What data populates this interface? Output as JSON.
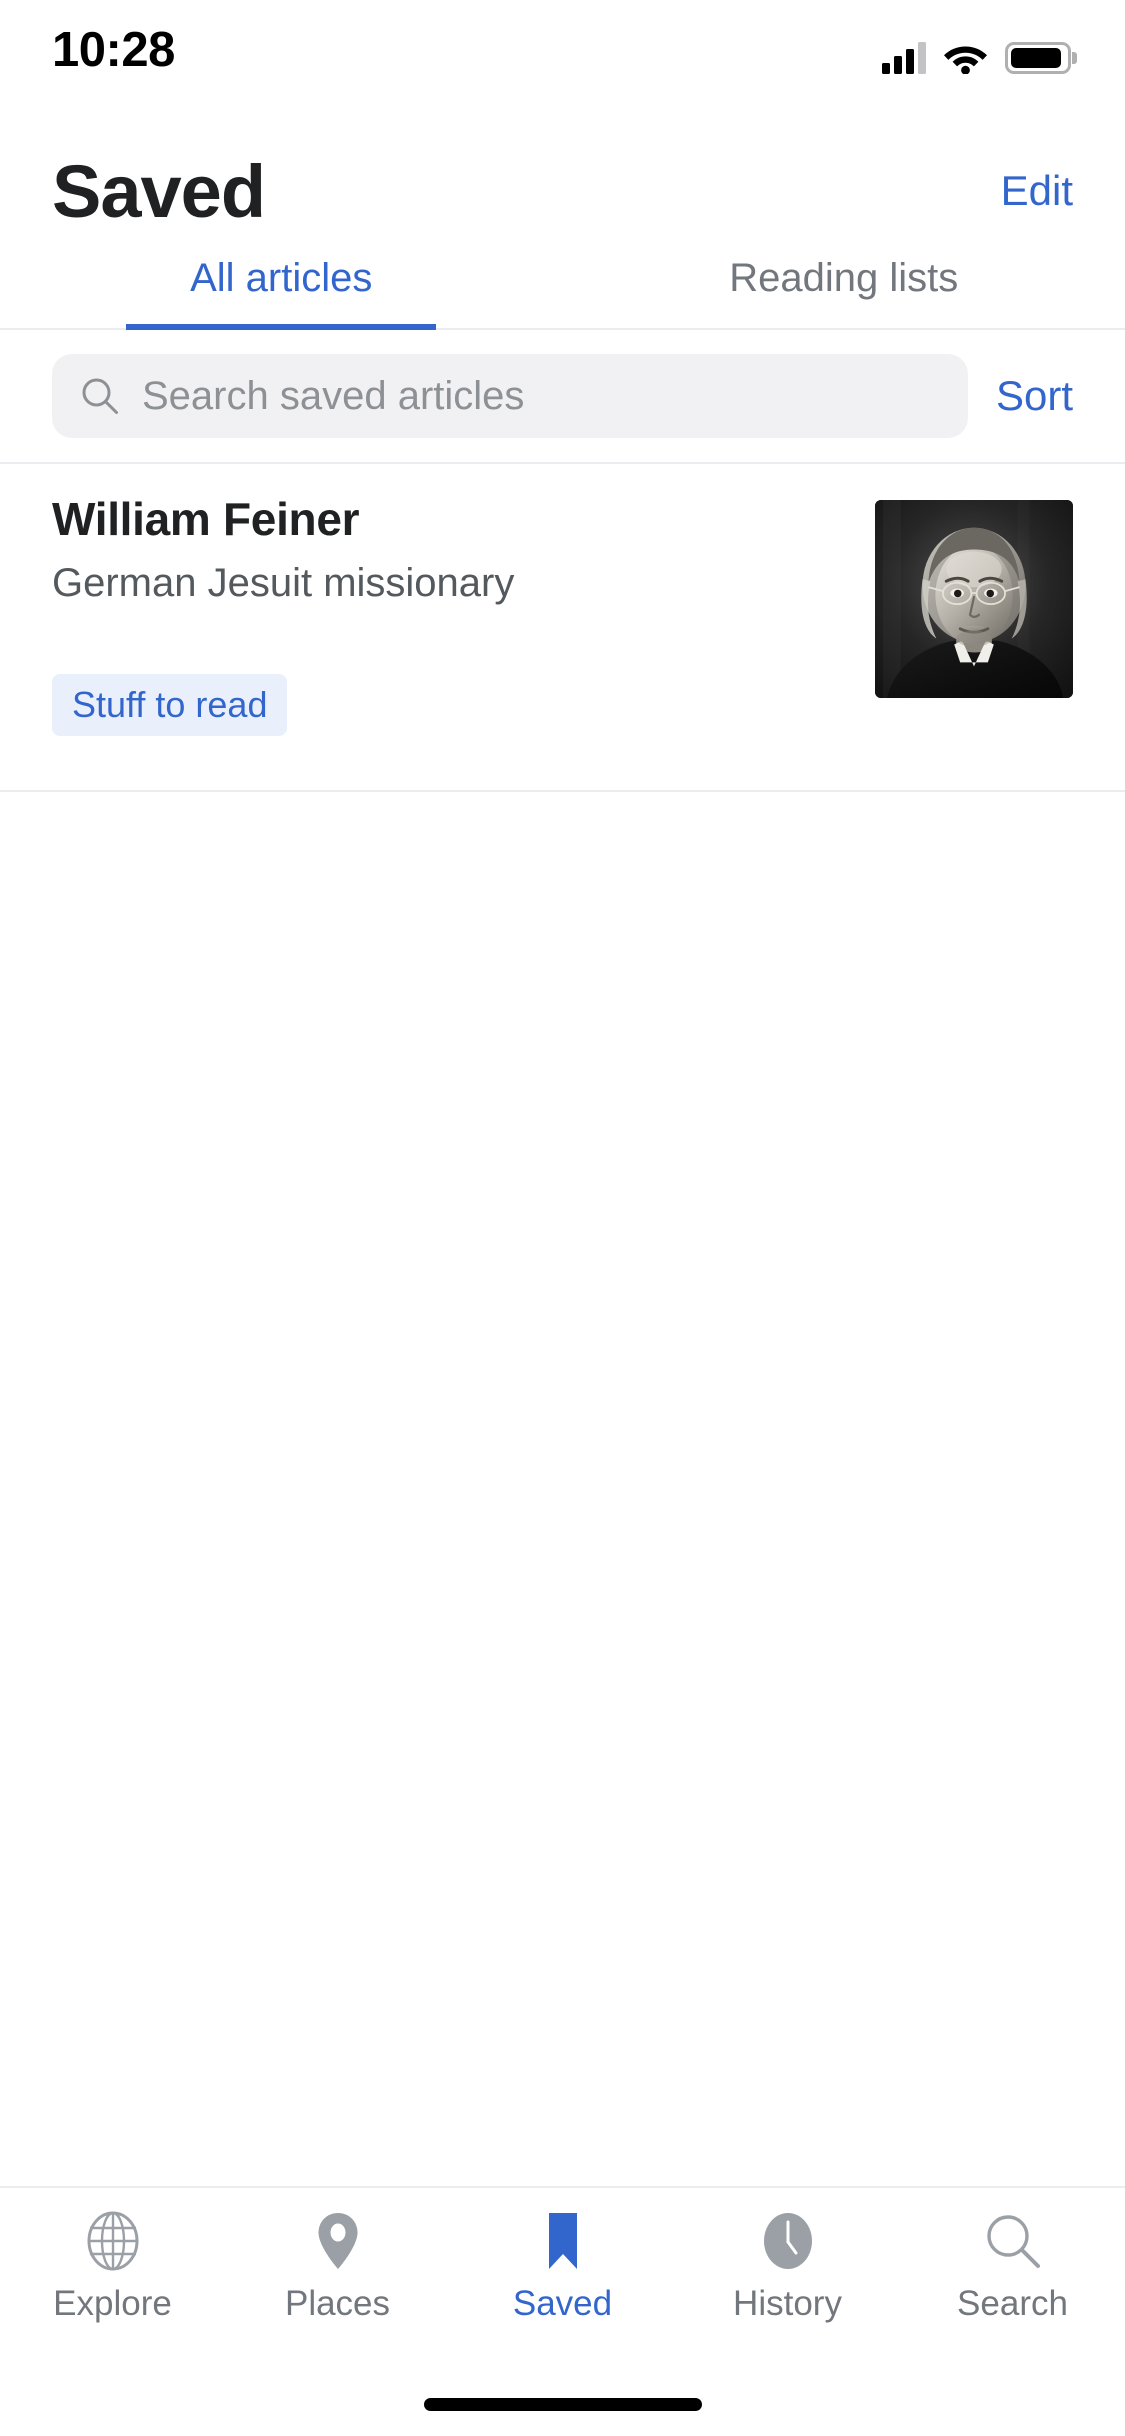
{
  "status_bar": {
    "time": "10:28",
    "signal_icon": "cellular-signal-icon",
    "signal_bars_filled": 3,
    "signal_bars_total": 4,
    "wifi_icon": "wifi-icon",
    "battery_icon": "battery-icon",
    "battery_level_percent": 92
  },
  "header": {
    "title": "Saved",
    "edit_label": "Edit"
  },
  "top_tabs": {
    "items": [
      {
        "label": "All articles",
        "active": true
      },
      {
        "label": "Reading lists",
        "active": false
      }
    ]
  },
  "search": {
    "icon": "search-icon",
    "placeholder": "Search saved articles",
    "value": "",
    "sort_label": "Sort"
  },
  "articles": [
    {
      "title": "William Feiner",
      "description": "German Jesuit missionary",
      "tags": [
        "Stuff to read"
      ],
      "thumbnail": "portrait-painting-of-man-with-glasses"
    }
  ],
  "bottom_tabs": {
    "items": [
      {
        "label": "Explore",
        "icon": "globe-icon",
        "active": false
      },
      {
        "label": "Places",
        "icon": "map-pin-icon",
        "active": false
      },
      {
        "label": "Saved",
        "icon": "bookmark-icon",
        "active": true
      },
      {
        "label": "History",
        "icon": "clock-icon",
        "active": false
      },
      {
        "label": "Search",
        "icon": "search-icon",
        "active": false
      }
    ]
  },
  "home_indicator": "home-indicator-bar",
  "colors": {
    "accent": "#3366cc",
    "text_primary": "#202122",
    "text_secondary": "#54595d",
    "text_muted": "#72777d",
    "chip_background": "#eaf0fb",
    "search_background": "#f1f1f3",
    "divider": "#eaecf0",
    "background": "#ffffff"
  }
}
